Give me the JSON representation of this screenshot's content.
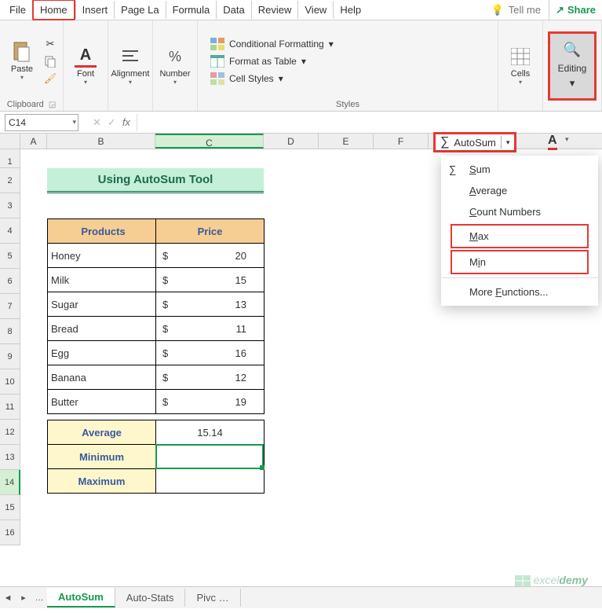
{
  "tabs": {
    "file": "File",
    "home": "Home",
    "insert": "Insert",
    "pagelayout": "Page La",
    "formulas": "Formula",
    "data": "Data",
    "review": "Review",
    "view": "View",
    "help": "Help",
    "tellme": "Tell me",
    "share": "Share"
  },
  "ribbon": {
    "clipboard": {
      "paste": "Paste",
      "label": "Clipboard"
    },
    "font": {
      "label": "Font"
    },
    "alignment": {
      "label": "Alignment"
    },
    "number": {
      "label": "Number"
    },
    "styles": {
      "cond": "Conditional Formatting",
      "table": "Format as Table",
      "cell": "Cell Styles",
      "label": "Styles"
    },
    "cells": {
      "label": "Cells"
    },
    "editing": {
      "label": "Editing"
    }
  },
  "namebox": "C14",
  "title": "Using AutoSum Tool",
  "headers": {
    "products": "Products",
    "price": "Price"
  },
  "rows": [
    {
      "product": "Honey",
      "currency": "$",
      "price": 20
    },
    {
      "product": "Milk",
      "currency": "$",
      "price": 15
    },
    {
      "product": "Sugar",
      "currency": "$",
      "price": 13
    },
    {
      "product": "Bread",
      "currency": "$",
      "price": 11
    },
    {
      "product": "Egg",
      "currency": "$",
      "price": 16
    },
    {
      "product": "Banana",
      "currency": "$",
      "price": 12
    },
    {
      "product": "Butter",
      "currency": "$",
      "price": 19
    }
  ],
  "summary": {
    "average_lbl": "Average",
    "average_val": "15.14",
    "min_lbl": "Minimum",
    "min_val": "",
    "max_lbl": "Maximum",
    "max_val": ""
  },
  "autosum_chip": "AutoSum",
  "menu": {
    "sum": "Sum",
    "avg": "Average",
    "count": "Count Numbers",
    "max": "Max",
    "min": "Min",
    "more": "More Functions..."
  },
  "sheets": {
    "s1": "AutoSum",
    "s2": "Auto-Stats",
    "s3": "Pivc"
  },
  "cols": [
    "A",
    "B",
    "C",
    "D",
    "E",
    "F"
  ],
  "watermark": {
    "a": "excel",
    "b": "demy"
  }
}
